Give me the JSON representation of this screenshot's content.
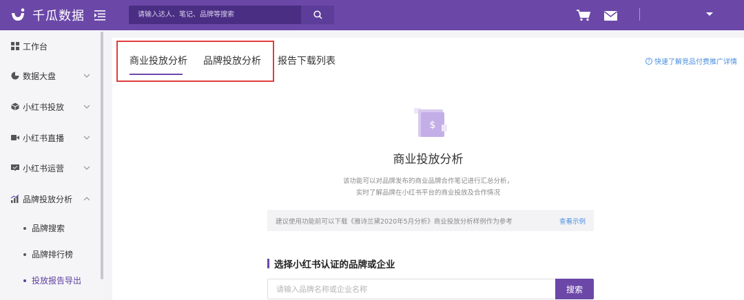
{
  "header": {
    "brand_name": "千瓜数据",
    "search_placeholder": "请输入达人、笔记、品牌等搜索",
    "icons": [
      "search-icon",
      "cart-icon",
      "mail-icon",
      "chevron-down-icon"
    ]
  },
  "sidebar": {
    "items": [
      {
        "label": "工作台",
        "icon": "grid-icon"
      },
      {
        "label": "数据大盘",
        "icon": "pie-chart-icon"
      },
      {
        "label": "小红书投放",
        "icon": "cube-icon"
      },
      {
        "label": "小红书直播",
        "icon": "video-icon"
      },
      {
        "label": "小红书运营",
        "icon": "chat-icon"
      },
      {
        "label": "品牌投放分析",
        "icon": "bar-chart-icon"
      }
    ],
    "sub_items": [
      {
        "label": "品牌搜索"
      },
      {
        "label": "品牌排行榜"
      },
      {
        "label": "投放报告导出",
        "active": true
      }
    ]
  },
  "main": {
    "tabs": [
      {
        "label": "商业投放分析",
        "active": true
      },
      {
        "label": "品牌投放分析"
      },
      {
        "label": "报告下载列表"
      }
    ],
    "help_link": "快速了解竞品付费推广详情",
    "hero_title": "商业投放分析",
    "description_line1": "该功能可以对品牌发布的商业品牌合作笔记进行汇总分析，",
    "description_line2": "实时了解品牌在小红书平台的商业投放及合作情况",
    "notice_text": "建议使用功能前可以下载《雅诗兰黛2020年5月分析》商业投放分析样例作为参考",
    "notice_link": "查看示例",
    "section_title": "选择小红书认证的品牌或企业",
    "brand_input_placeholder": "请输入品牌名称或企业名称",
    "search_button": "搜索"
  },
  "colors": {
    "header_bg": "#6b48a8",
    "accent": "#6b48a8",
    "link": "#4a8ede",
    "highlight_border": "#e23b3b"
  }
}
